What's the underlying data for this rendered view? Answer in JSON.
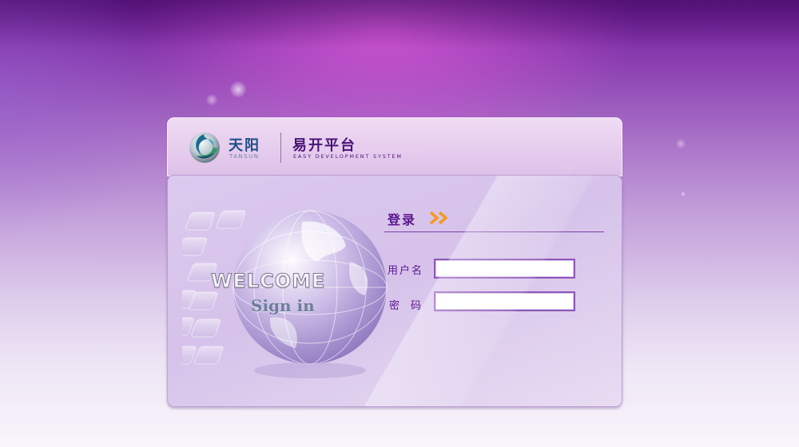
{
  "brand": {
    "name_cn": "天阳",
    "name_en": "TANSUN",
    "icon": "tansun-swirl-logo-icon"
  },
  "platform": {
    "name_cn": "易开平台",
    "name_en": "EASY DEVELOPMENT SYSTEM"
  },
  "welcome": {
    "line1": "WELCOME",
    "line2": "Sign in",
    "illustration": "globe-on-keyboard-illustration"
  },
  "login": {
    "title": "登录",
    "title_icon": "double-chevron-right-icon",
    "username_label": "用户名",
    "username_value": "",
    "password_label": "密码",
    "password_value": ""
  },
  "colors": {
    "primary_purple": "#5a168e",
    "arrow_orange": "#f39a1e",
    "brand_blue": "#1d4f8a",
    "background_top": "#6d1a96",
    "background_bottom": "#f8f5fb"
  }
}
